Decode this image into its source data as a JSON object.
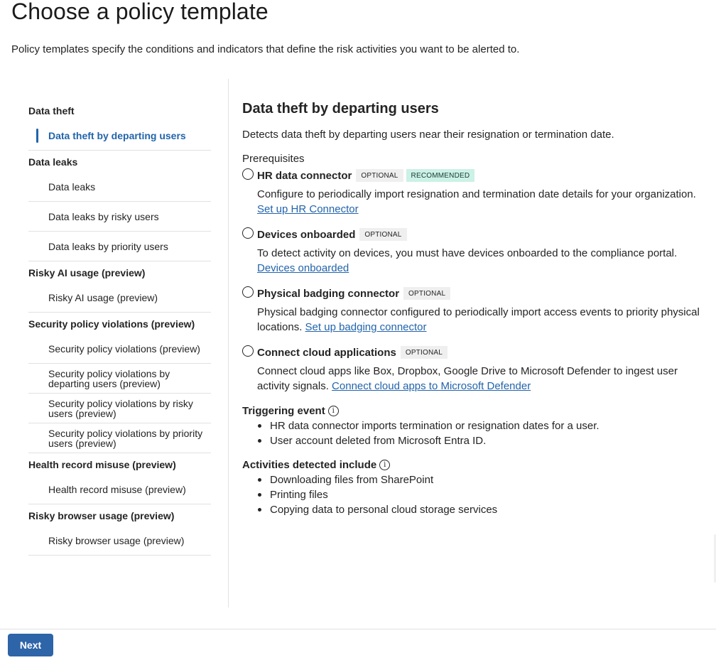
{
  "page": {
    "title": "Choose a policy template",
    "description": "Policy templates specify the conditions and indicators that define the risk activities you want to be alerted to."
  },
  "nav": {
    "groups": [
      {
        "title": "Data theft",
        "items": [
          "Data theft by departing users"
        ]
      },
      {
        "title": "Data leaks",
        "items": [
          "Data leaks",
          "Data leaks by risky users",
          "Data leaks by priority users"
        ]
      },
      {
        "title": "Risky AI usage (preview)",
        "items": [
          "Risky AI usage (preview)"
        ]
      },
      {
        "title": "Security policy violations (preview)",
        "items": [
          "Security policy violations (preview)",
          "Security policy violations by departing users (preview)",
          "Security policy violations by risky users (preview)",
          "Security policy violations by priority users (preview)"
        ]
      },
      {
        "title": "Health record misuse (preview)",
        "items": [
          "Health record misuse (preview)"
        ]
      },
      {
        "title": "Risky browser usage (preview)",
        "items": [
          "Risky browser usage (preview)"
        ]
      }
    ],
    "selected": "Data theft by departing users"
  },
  "detail": {
    "title": "Data theft by departing users",
    "description": "Detects data theft by departing users near their resignation or termination date.",
    "prerequisites_label": "Prerequisites",
    "prerequisites": [
      {
        "name": "HR data connector",
        "tags": [
          "OPTIONAL",
          "RECOMMENDED"
        ],
        "text": "Configure to periodically import resignation and termination date details for your organization.",
        "link": "Set up HR Connector"
      },
      {
        "name": "Devices onboarded",
        "tags": [
          "OPTIONAL"
        ],
        "text": "To detect activity on devices, you must have devices onboarded to the compliance portal.",
        "link": "Devices onboarded"
      },
      {
        "name": "Physical badging connector",
        "tags": [
          "OPTIONAL"
        ],
        "text": "Physical badging connector configured to periodically import access events to priority physical locations.",
        "link": "Set up badging connector"
      },
      {
        "name": "Connect cloud applications",
        "tags": [
          "OPTIONAL"
        ],
        "text": "Connect cloud apps like Box, Dropbox, Google Drive to Microsoft Defender to ingest user activity signals.",
        "link": "Connect cloud apps to Microsoft Defender"
      }
    ],
    "triggering_event": {
      "label": "Triggering event",
      "items": [
        "HR data connector imports termination or resignation dates for a user.",
        "User account deleted from Microsoft Entra ID."
      ]
    },
    "activities": {
      "label": "Activities detected include",
      "items": [
        "Downloading files from SharePoint",
        "Printing files",
        "Copying data to personal cloud storage services"
      ]
    }
  },
  "footer": {
    "next_label": "Next"
  },
  "icons": {
    "info": "info-icon",
    "radio": "radio-icon"
  },
  "colors": {
    "accent": "#2264ab",
    "recommended_tag": "#ccf1e6",
    "optional_tag": "#efefef",
    "button": "#2e64a8"
  }
}
